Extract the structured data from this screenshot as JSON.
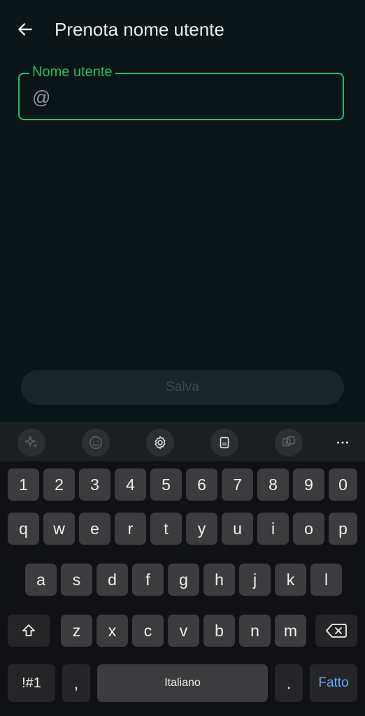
{
  "header": {
    "title": "Prenota nome utente",
    "back_icon": "arrow-left-icon"
  },
  "username_field": {
    "label": "Nome utente",
    "prefix": "@",
    "value": "",
    "placeholder": ""
  },
  "save_button": {
    "label": "Salva"
  },
  "colors": {
    "accent": "#21c063",
    "background": "#0b1417",
    "done_key": "#6aa7ff"
  },
  "keyboard_toolbar": {
    "icons": [
      "ai-sparkle-icon",
      "emoji-icon",
      "settings-icon",
      "keyboard-mode-icon",
      "translate-icon",
      "more-icon"
    ]
  },
  "keyboard": {
    "row_numbers": [
      "1",
      "2",
      "3",
      "4",
      "5",
      "6",
      "7",
      "8",
      "9",
      "0"
    ],
    "row_1": [
      "q",
      "w",
      "e",
      "r",
      "t",
      "y",
      "u",
      "i",
      "o",
      "p"
    ],
    "row_2": [
      "a",
      "s",
      "d",
      "f",
      "g",
      "h",
      "j",
      "k",
      "l"
    ],
    "row_3": [
      "z",
      "x",
      "c",
      "v",
      "b",
      "n",
      "m"
    ],
    "symbols_key": "!#1",
    "comma_key": ",",
    "space_label": "Italiano",
    "period_key": ".",
    "done_label": "Fatto"
  }
}
